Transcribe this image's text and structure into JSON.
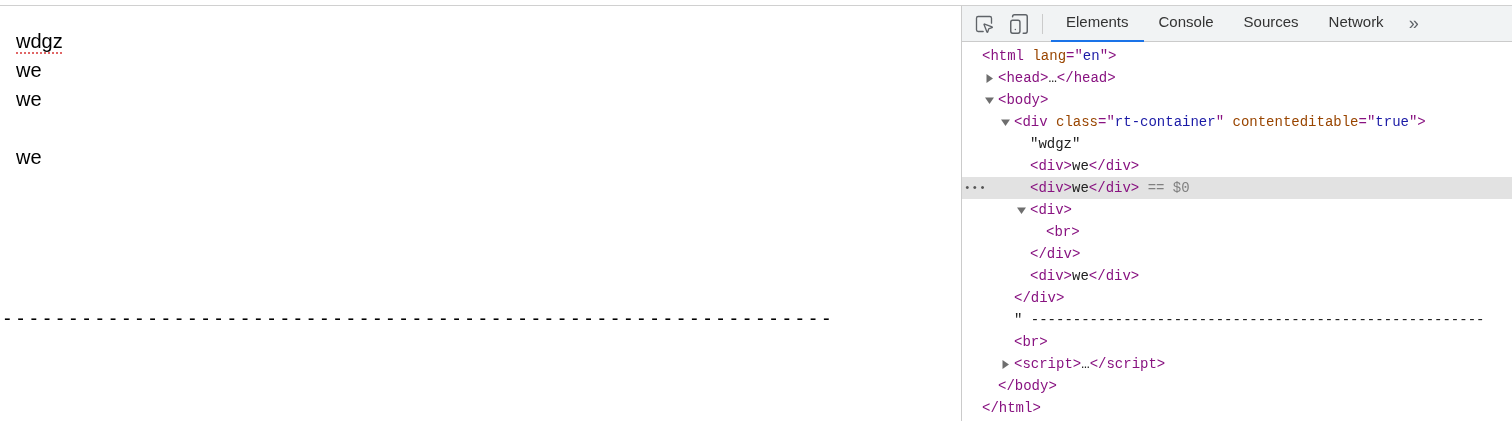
{
  "page": {
    "lines": [
      {
        "kind": "text",
        "text": "wdgz",
        "misspelled": true
      },
      {
        "kind": "text",
        "text": "we",
        "misspelled": false
      },
      {
        "kind": "text",
        "text": "we",
        "misspelled": false
      },
      {
        "kind": "blank"
      },
      {
        "kind": "text",
        "text": "we",
        "misspelled": false
      }
    ],
    "separator": "---------------------------------------------------------------"
  },
  "devtools": {
    "tabs": [
      {
        "label": "Elements",
        "selected": true
      },
      {
        "label": "Console",
        "selected": false
      },
      {
        "label": "Sources",
        "selected": false
      },
      {
        "label": "Network",
        "selected": false
      }
    ],
    "more": "»",
    "tree": [
      {
        "kind": "leaf",
        "selected": false,
        "parts": [
          {
            "kind": "tag",
            "text": "<html "
          },
          {
            "kind": "attr_name",
            "text": "lang"
          },
          {
            "kind": "tag",
            "text": "=\""
          },
          {
            "kind": "attr_value",
            "text": "en"
          },
          {
            "kind": "tag",
            "text": "\">"
          }
        ],
        "children": [
          {
            "kind": "toggle",
            "expanded": false,
            "selected": false,
            "parts": [
              {
                "kind": "tag",
                "text": "<head>"
              },
              {
                "kind": "text",
                "text": "…"
              },
              {
                "kind": "tag",
                "text": "</head>"
              }
            ]
          },
          {
            "kind": "toggle",
            "expanded": true,
            "selected": false,
            "parts": [
              {
                "kind": "tag",
                "text": "<body>"
              }
            ],
            "children": [
              {
                "kind": "toggle",
                "expanded": true,
                "selected": false,
                "parts": [
                  {
                    "kind": "tag",
                    "text": "<div "
                  },
                  {
                    "kind": "attr_name",
                    "text": "class"
                  },
                  {
                    "kind": "tag",
                    "text": "=\""
                  },
                  {
                    "kind": "attr_value",
                    "text": "rt-container"
                  },
                  {
                    "kind": "tag",
                    "text": "\" "
                  },
                  {
                    "kind": "attr_name",
                    "text": "contenteditable"
                  },
                  {
                    "kind": "tag",
                    "text": "=\""
                  },
                  {
                    "kind": "attr_value",
                    "text": "true"
                  },
                  {
                    "kind": "tag",
                    "text": "\">"
                  }
                ],
                "children": [
                  {
                    "kind": "leaf",
                    "selected": false,
                    "parts": [
                      {
                        "kind": "text",
                        "text": "\"wdgz\""
                      }
                    ]
                  },
                  {
                    "kind": "leaf",
                    "selected": false,
                    "parts": [
                      {
                        "kind": "tag",
                        "text": "<div>"
                      },
                      {
                        "kind": "text",
                        "text": "we"
                      },
                      {
                        "kind": "tag",
                        "text": "</div>"
                      }
                    ]
                  },
                  {
                    "kind": "leaf",
                    "selected": true,
                    "menu": "•••",
                    "parts": [
                      {
                        "kind": "tag",
                        "text": "<div>"
                      },
                      {
                        "kind": "text",
                        "text": "we"
                      },
                      {
                        "kind": "tag",
                        "text": "</div>"
                      },
                      {
                        "kind": "hint",
                        "text": " == $0"
                      }
                    ]
                  },
                  {
                    "kind": "toggle",
                    "expanded": true,
                    "selected": false,
                    "parts": [
                      {
                        "kind": "tag",
                        "text": "<div>"
                      }
                    ],
                    "children": [
                      {
                        "kind": "leaf",
                        "selected": false,
                        "parts": [
                          {
                            "kind": "tag",
                            "text": "<br>"
                          }
                        ]
                      }
                    ]
                  },
                  {
                    "kind": "leaf",
                    "selected": false,
                    "parts": [
                      {
                        "kind": "tag",
                        "text": "</div>"
                      }
                    ]
                  },
                  {
                    "kind": "leaf",
                    "selected": false,
                    "parts": [
                      {
                        "kind": "tag",
                        "text": "<div>"
                      },
                      {
                        "kind": "text",
                        "text": "we"
                      },
                      {
                        "kind": "tag",
                        "text": "</div>"
                      }
                    ]
                  }
                ]
              },
              {
                "kind": "leaf",
                "selected": false,
                "parts": [
                  {
                    "kind": "tag",
                    "text": "</div>"
                  }
                ]
              },
              {
                "kind": "leaf",
                "selected": false,
                "parts": [
                  {
                    "kind": "text",
                    "text": "\" ------------------------------------------------------"
                  }
                ]
              },
              {
                "kind": "leaf",
                "selected": false,
                "parts": [
                  {
                    "kind": "tag",
                    "text": "<br>"
                  }
                ]
              },
              {
                "kind": "toggle",
                "expanded": false,
                "selected": false,
                "parts": [
                  {
                    "kind": "tag",
                    "text": "<script>"
                  },
                  {
                    "kind": "text",
                    "text": "…"
                  },
                  {
                    "kind": "tag",
                    "text": "</script>"
                  }
                ]
              }
            ]
          },
          {
            "kind": "leaf",
            "selected": false,
            "parts": [
              {
                "kind": "tag",
                "text": "</body>"
              }
            ]
          }
        ]
      },
      {
        "kind": "leaf",
        "selected": false,
        "parts": [
          {
            "kind": "tag",
            "text": "</html>"
          }
        ]
      }
    ]
  }
}
